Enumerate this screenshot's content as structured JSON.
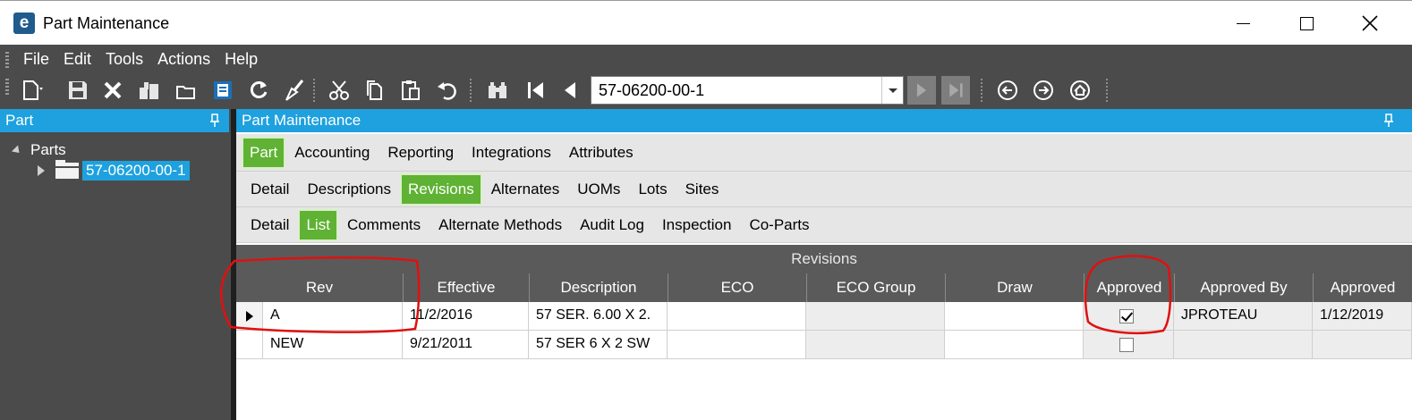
{
  "window": {
    "title": "Part Maintenance",
    "logo_letter": "e"
  },
  "menu": [
    "File",
    "Edit",
    "Tools",
    "Actions",
    "Help"
  ],
  "toolbar": {
    "part_combo_value": "57-06200-00-1",
    "icons": [
      "new-icon",
      "save-icon",
      "delete-icon",
      "attach-icon",
      "clear-icon",
      "print-icon",
      "refresh-icon",
      "clean-icon",
      "cut-icon",
      "copy-icon",
      "paste-icon",
      "undo-icon",
      "search-icon",
      "first-record-icon",
      "previous-record-icon",
      "next-record-icon",
      "last-record-icon",
      "back-icon",
      "forward-icon",
      "home-icon"
    ]
  },
  "left_panel": {
    "header": "Part",
    "tree_root": "Parts",
    "tree_child": "57-06200-00-1"
  },
  "right_panel": {
    "header": "Part Maintenance",
    "tabs_level1": [
      "Part",
      "Accounting",
      "Reporting",
      "Integrations",
      "Attributes"
    ],
    "tabs_level2": [
      "Detail",
      "Descriptions",
      "Revisions",
      "Alternates",
      "UOMs",
      "Lots",
      "Sites"
    ],
    "tabs_level3": [
      "Detail",
      "List",
      "Comments",
      "Alternate Methods",
      "Audit Log",
      "Inspection",
      "Co-Parts"
    ],
    "active": {
      "level1": "Part",
      "level2": "Revisions",
      "level3": "List"
    }
  },
  "grid": {
    "title": "Revisions",
    "columns": [
      "Rev",
      "Effective",
      "Description",
      "ECO",
      "ECO Group",
      "Draw",
      "Approved",
      "Approved By",
      "Approved"
    ],
    "rows": [
      {
        "rev": "A",
        "effective": "11/2/2016",
        "description": "57 SER. 6.00 X 2.",
        "eco": "",
        "eco_group": "",
        "draw": "",
        "approved": true,
        "approved_by": "JPROTEAU",
        "approved_date": "1/12/2019"
      },
      {
        "rev": "NEW",
        "effective": "9/21/2011",
        "description": "57 SER 6 X 2 SW",
        "eco": "",
        "eco_group": "",
        "draw": "",
        "approved": false,
        "approved_by": "",
        "approved_date": ""
      }
    ]
  },
  "colors": {
    "accent_blue": "#1ea1de",
    "tab_green": "#5fb233",
    "chrome_gray": "#4b4b4b",
    "annotation_red": "#e01010"
  }
}
